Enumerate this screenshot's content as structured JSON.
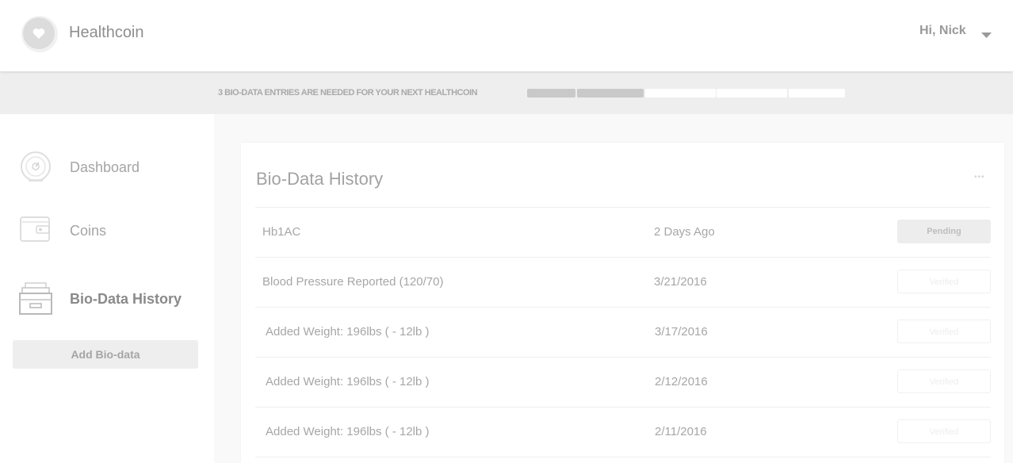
{
  "header": {
    "brand": "Healthcoin",
    "greeting": "Hi, Nick"
  },
  "progress": {
    "message": "3 BIO-DATA ENTRIES ARE NEEDED FOR YOUR NEXT HEALTHCOIN",
    "completed_segments": 2,
    "total_segments": 5
  },
  "sidebar": {
    "items": [
      {
        "label": "Dashboard",
        "icon": "gauge-icon",
        "active": false
      },
      {
        "label": "Coins",
        "icon": "wallet-icon",
        "active": false
      },
      {
        "label": "Bio-Data History",
        "icon": "file-drawer-icon",
        "active": true
      }
    ],
    "add_button": "Add Bio-data"
  },
  "main": {
    "title": "Bio-Data History",
    "more_label": "•••",
    "rows": [
      {
        "name": "Hb1AC",
        "date": "2 Days Ago",
        "status": "Pending"
      },
      {
        "name": "Blood Pressure Reported (120/70)",
        "date": "3/21/2016",
        "status": "Verified"
      },
      {
        "name": "Added Weight: 196lbs ( - 12lb )",
        "date": "3/17/2016",
        "status": "Verified"
      },
      {
        "name": "Added Weight: 196lbs ( - 12lb )",
        "date": "2/12/2016",
        "status": "Verified"
      },
      {
        "name": "Added Weight: 196lbs ( - 12lb )",
        "date": "2/11/2016",
        "status": "Verified"
      }
    ]
  },
  "colors": {
    "background": "#f9f9f9",
    "panel": "#ffffff",
    "strip": "#eeeeee",
    "progress_on": "#c9c9c9",
    "text": "#9a9a9a"
  }
}
